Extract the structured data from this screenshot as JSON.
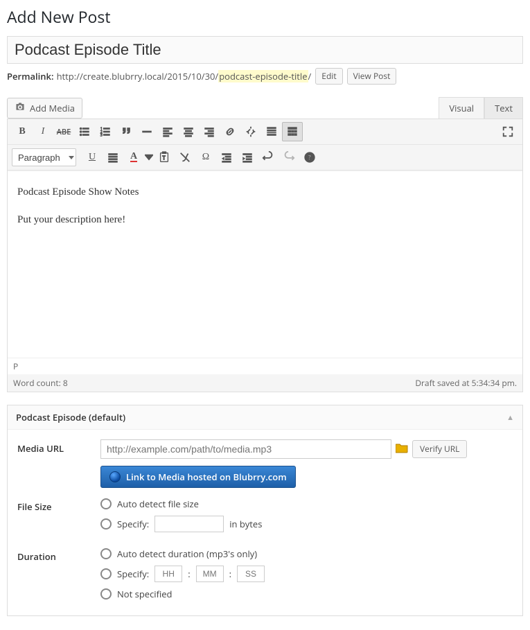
{
  "page": {
    "heading": "Add New Post"
  },
  "post": {
    "title_value": "Podcast Episode Title",
    "permalink_label": "Permalink:",
    "permalink_base": "http://create.blubrry.local/2015/10/30/",
    "permalink_slug": "podcast-episode-title",
    "permalink_trailing": "/",
    "edit_label": "Edit",
    "view_label": "View Post"
  },
  "editor": {
    "add_media_label": "Add Media",
    "tab_visual": "Visual",
    "tab_text": "Text",
    "format_select_value": "Paragraph",
    "content_line1": "Podcast Episode Show Notes",
    "content_line2": "Put your description here!",
    "path_indicator": "P",
    "word_count_label": "Word count: 8",
    "draft_saved_label": "Draft saved at 5:34:34 pm."
  },
  "podcast": {
    "box_title": "Podcast Episode (default)",
    "media_url_label": "Media URL",
    "media_url_placeholder": "http://example.com/path/to/media.mp3",
    "verify_label": "Verify URL",
    "blubrry_button": "Link to Media hosted on Blubrry.com",
    "file_size_label": "File Size",
    "fs_auto": "Auto detect file size",
    "fs_specify": "Specify:",
    "fs_unit": "in bytes",
    "duration_label": "Duration",
    "dur_auto": "Auto detect duration (mp3's only)",
    "dur_specify": "Specify:",
    "dur_hh": "HH",
    "dur_mm": "MM",
    "dur_ss": "SS",
    "dur_not_specified": "Not specified"
  }
}
